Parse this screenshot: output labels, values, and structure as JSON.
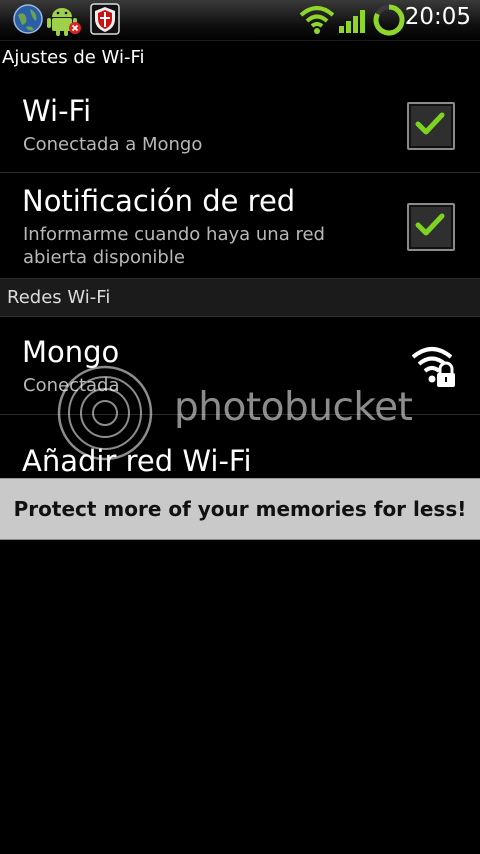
{
  "status_bar": {
    "left_icons": [
      "globe-icon",
      "android-debug-icon",
      "shield-app-icon"
    ],
    "right_icons": [
      "wifi-signal-icon",
      "cell-signal-icon",
      "sync-icon"
    ],
    "time": "20:05"
  },
  "title": "Ajustes de Wi-Fi",
  "settings": {
    "wifi": {
      "title": "Wi-Fi",
      "subtitle": "Conectada a Mongo",
      "checked": true
    },
    "notification": {
      "title": "Notificación de red",
      "subtitle_line1": "Informarme cuando haya una red",
      "subtitle_line2": "abierta disponible",
      "checked": true
    }
  },
  "section_header": "Redes Wi-Fi",
  "networks": [
    {
      "name": "Mongo",
      "status": "Conectada",
      "icon": "wifi-lock-icon"
    }
  ],
  "add_network": "Añadir red Wi-Fi",
  "watermark": {
    "text": "photobucket"
  },
  "banner": "Protect more of your memories for less!",
  "colors": {
    "check_green": "#7ed321",
    "signal_green": "#8fd62a",
    "banner_bg": "#c9c9c9"
  }
}
